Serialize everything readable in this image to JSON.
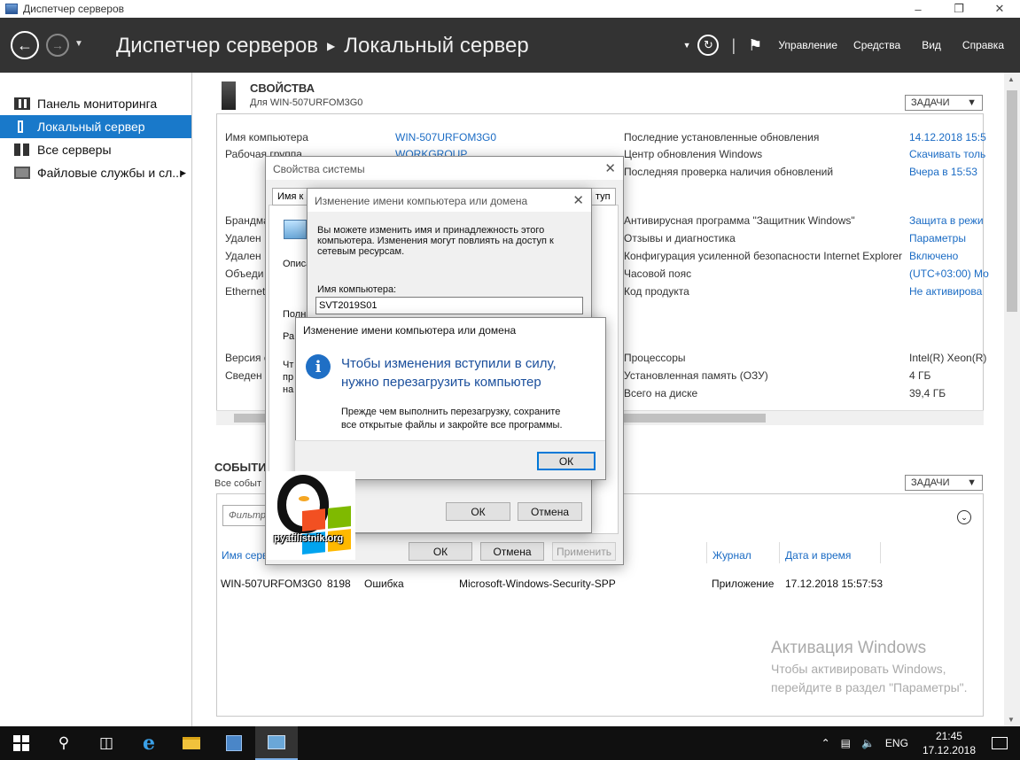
{
  "window": {
    "title": "Диспетчер серверов"
  },
  "header": {
    "breadcrumb_root": "Диспетчер серверов",
    "breadcrumb_current": "Локальный сервер",
    "menu": [
      "Управление",
      "Средства",
      "Вид",
      "Справка"
    ]
  },
  "sidebar": {
    "items": [
      {
        "label": "Панель мониторинга"
      },
      {
        "label": "Локальный сервер"
      },
      {
        "label": "Все серверы"
      },
      {
        "label": "Файловые службы и сл..."
      }
    ]
  },
  "properties": {
    "title": "СВОЙСТВА",
    "subtitle": "Для WIN-507URFOM3G0",
    "tasks_label": "ЗАДАЧИ",
    "left_labels": [
      "Имя компьютера",
      "Рабочая группа",
      "Брандма",
      "Удален",
      "Удален",
      "Объеди",
      "Ethernet",
      "Версия с",
      "Сведен"
    ],
    "computer_name": "WIN-507URFOM3G0",
    "workgroup": "WORKGROUP",
    "right": [
      {
        "label": "Последние установленные обновления",
        "value": "14.12.2018 15:5"
      },
      {
        "label": "Центр обновления Windows",
        "value": "Скачивать толь"
      },
      {
        "label": "Последняя проверка наличия обновлений",
        "value": "Вчера в 15:53"
      },
      {
        "label": "Антивирусная программа \"Защитник Windows\"",
        "value": "Защита в режи"
      },
      {
        "label": "Отзывы и диагностика",
        "value": "Параметры"
      },
      {
        "label": "Конфигурация усиленной безопасности Internet Explorer",
        "value": "Включено"
      },
      {
        "label": "Часовой пояс",
        "value": "(UTC+03:00) Мо"
      },
      {
        "label": "Код продукта",
        "value": "Не активирова"
      },
      {
        "label": "Процессоры",
        "value": "Intel(R) Xeon(R)"
      },
      {
        "label": "Установленная память (ОЗУ)",
        "value": "4 ГБ"
      },
      {
        "label": "Всего на диске",
        "value": "39,4 ГБ"
      }
    ]
  },
  "events": {
    "title": "СОБЫТИ",
    "subtitle": "Все событ",
    "tasks_label": "ЗАДАЧИ",
    "filter_placeholder": "Фильтр",
    "columns": [
      "Имя серв",
      "Журнал",
      "Дата и время"
    ],
    "rows": [
      {
        "server": "WIN-507URFOM3G0",
        "id": "8198",
        "level": "Ошибка",
        "source": "Microsoft-Windows-Security-SPP",
        "log": "Приложение",
        "datetime": "17.12.2018 15:57:53"
      }
    ]
  },
  "watermark": {
    "title": "Активация Windows",
    "line1": "Чтобы активировать Windows,",
    "line2": "перейдите в раздел \"Параметры\"."
  },
  "sysprops_dialog": {
    "title": "Свойства системы",
    "tab_left": "Имя к",
    "tab_right": "туп",
    "frag_opis": "Описа",
    "frag_poln": "Полн",
    "frag_ra": "Ра",
    "frag_cht": "Чт",
    "frag_pr": "пр",
    "frag_na": "на",
    "ok": "ОК",
    "cancel": "Отмена",
    "apply": "Применить"
  },
  "rename_dialog": {
    "title": "Изменение имени компьютера или домена",
    "desc1": "Вы можете изменить имя и принадлежность этого",
    "desc2": "компьютера. Изменения могут повлиять на доступ к",
    "desc3": "сетевым ресурсам.",
    "name_label": "Имя компьютера:",
    "name_value": "SVT2019S01",
    "ok": "ОК",
    "cancel": "Отмена"
  },
  "message_dialog": {
    "title": "Изменение имени компьютера или домена",
    "main1": "Чтобы изменения вступили в силу,",
    "main2": "нужно перезагрузить компьютер",
    "sub1": "Прежде чем выполнить перезагрузку, сохраните",
    "sub2": "все открытые файлы и закройте все программы.",
    "ok": "ОК"
  },
  "logo": {
    "text": "pyatilistnik.org"
  },
  "taskbar": {
    "lang": "ENG",
    "time": "21:45",
    "date": "17.12.2018"
  }
}
